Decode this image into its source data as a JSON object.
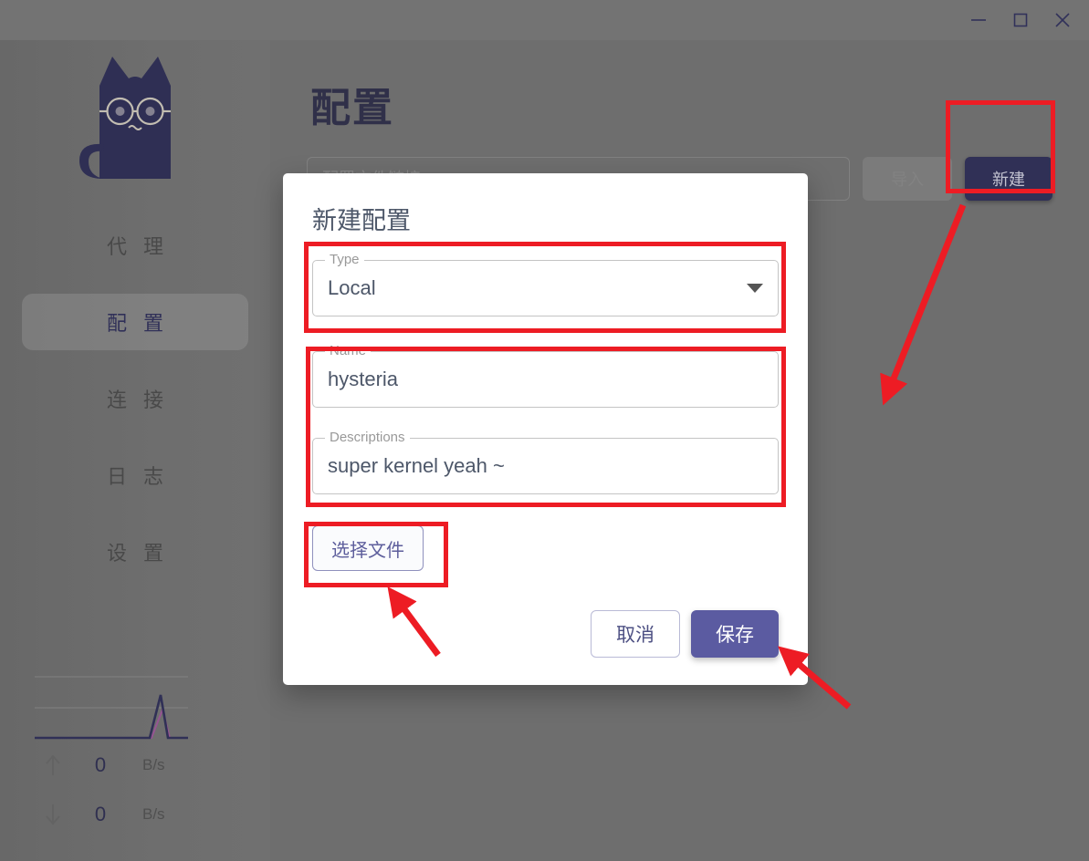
{
  "window": {
    "controls": [
      {
        "name": "minimize",
        "glyph": "minimize-icon"
      },
      {
        "name": "maximize",
        "glyph": "maximize-icon"
      },
      {
        "name": "close",
        "glyph": "close-icon"
      }
    ]
  },
  "sidebar": {
    "logo": "cat-with-glasses-logo",
    "items": [
      {
        "label": "代 理",
        "active": false
      },
      {
        "label": "配 置",
        "active": true
      },
      {
        "label": "连 接",
        "active": false
      },
      {
        "label": "日 志",
        "active": false
      },
      {
        "label": "设 置",
        "active": false
      }
    ],
    "traffic": {
      "upload": {
        "icon": "arrow-up-icon",
        "value": "0",
        "unit": "B/s"
      },
      "download": {
        "icon": "arrow-down-icon",
        "value": "0",
        "unit": "B/s"
      }
    }
  },
  "main": {
    "title": "配置",
    "url_input": {
      "value": "",
      "placeholder": "配置文件链接"
    },
    "import_button": "导入",
    "new_button": "新建"
  },
  "modal": {
    "title": "新建配置",
    "fields": {
      "type": {
        "label": "Type",
        "value": "Local"
      },
      "name": {
        "label": "Name",
        "value": "hysteria"
      },
      "descriptions": {
        "label": "Descriptions",
        "value": "super kernel yeah ~"
      }
    },
    "choose_file_button": "选择文件",
    "cancel_button": "取消",
    "save_button": "保存"
  },
  "colors": {
    "app_background": "#757575",
    "accent_indigo": "#33335c",
    "save_purple": "#5b5ba1",
    "annotation_red": "#ed1c24",
    "chart_line": "#33335c",
    "chart_line_secondary": "#a05a9c"
  },
  "chart_data": {
    "type": "line",
    "title": "",
    "x": [
      0,
      1,
      2,
      3,
      4,
      5,
      6,
      7,
      8,
      9,
      10,
      11,
      12,
      13,
      14,
      15,
      16,
      17,
      18,
      19,
      20,
      21,
      22,
      23,
      24,
      25,
      26,
      27,
      28,
      29
    ],
    "series": [
      {
        "name": "upload",
        "values": [
          0,
          0,
          0,
          0,
          0,
          0,
          0,
          0,
          0,
          0,
          0,
          0,
          0,
          0,
          0,
          0,
          0,
          0,
          0,
          0,
          0,
          0,
          0,
          0,
          0,
          0,
          0,
          72,
          0,
          0
        ]
      },
      {
        "name": "download",
        "values": [
          0,
          0,
          0,
          0,
          0,
          0,
          0,
          0,
          0,
          0,
          0,
          0,
          0,
          0,
          0,
          0,
          0,
          0,
          0,
          0,
          0,
          0,
          0,
          0,
          0,
          0,
          0,
          40,
          0,
          0
        ]
      }
    ],
    "ylim": [
      0,
      100
    ],
    "grid": true,
    "legend": false,
    "xlabel": "",
    "ylabel": ""
  }
}
